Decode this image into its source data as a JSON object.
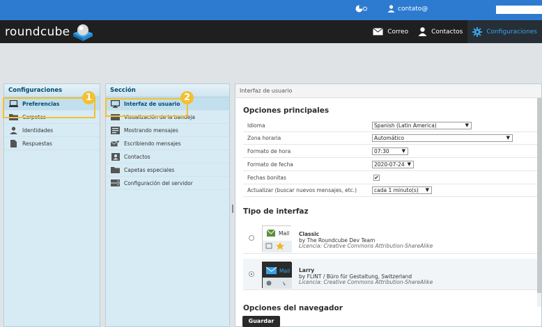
{
  "topbar": {
    "user": "contato@"
  },
  "header": {
    "logo": "roundcube",
    "nav": [
      {
        "label": "Correo",
        "icon": "envelope-icon"
      },
      {
        "label": "Contactos",
        "icon": "person-icon"
      },
      {
        "label": "Configuraciones",
        "icon": "gear-icon"
      }
    ]
  },
  "settings_panel": {
    "title": "Configuraciones",
    "items": [
      "Preferencias",
      "Carpetas",
      "Identidades",
      "Respuestas"
    ]
  },
  "section_panel": {
    "title": "Sección",
    "items": [
      "Interfaz de usuario",
      "Visualización de la bandeja",
      "Mostrando mensajes",
      "Escribiendo mensajes",
      "Contactos",
      "Capetas especiales",
      "Configuración del servidor"
    ]
  },
  "annotations": {
    "badge1": "1",
    "badge2": "2"
  },
  "content": {
    "header": "Interfaz de usuario",
    "main_title": "Opciones principales",
    "rows": [
      {
        "label": "Idioma",
        "value": "Spanish (Latin America)"
      },
      {
        "label": "Zona horaria",
        "value": "Automático"
      },
      {
        "label": "Formato de hora",
        "value": "07:30"
      },
      {
        "label": "Formato de fecha",
        "value": "2020-07-24"
      },
      {
        "label": "Fechas bonitas",
        "checked": true
      },
      {
        "label": "Actualizar (buscar nuevos mensajes, etc.)",
        "value": "cada 1 minuto(s)"
      }
    ],
    "interface_title": "Tipo de interfaz",
    "skins": [
      {
        "name": "Classic",
        "author": "by The Roundcube Dev Team",
        "license": "Licencia: Creative Commons Attribution-ShareAlike",
        "thumb_label": "Mail",
        "selected": false
      },
      {
        "name": "Larry",
        "author": "by FLINT / Büro für Gestaltung, Switzerland",
        "license": "Licencia: Creative Commons Attribution-ShareAlike",
        "thumb_label": "Mail",
        "selected": true
      }
    ],
    "browser_title": "Opciones del navegador",
    "save": "Guardar"
  },
  "colors": {
    "topbar": "#2d7bd1",
    "header": "#1f1f1f",
    "accent": "#37a4e8",
    "highlight": "#f3c02f"
  }
}
